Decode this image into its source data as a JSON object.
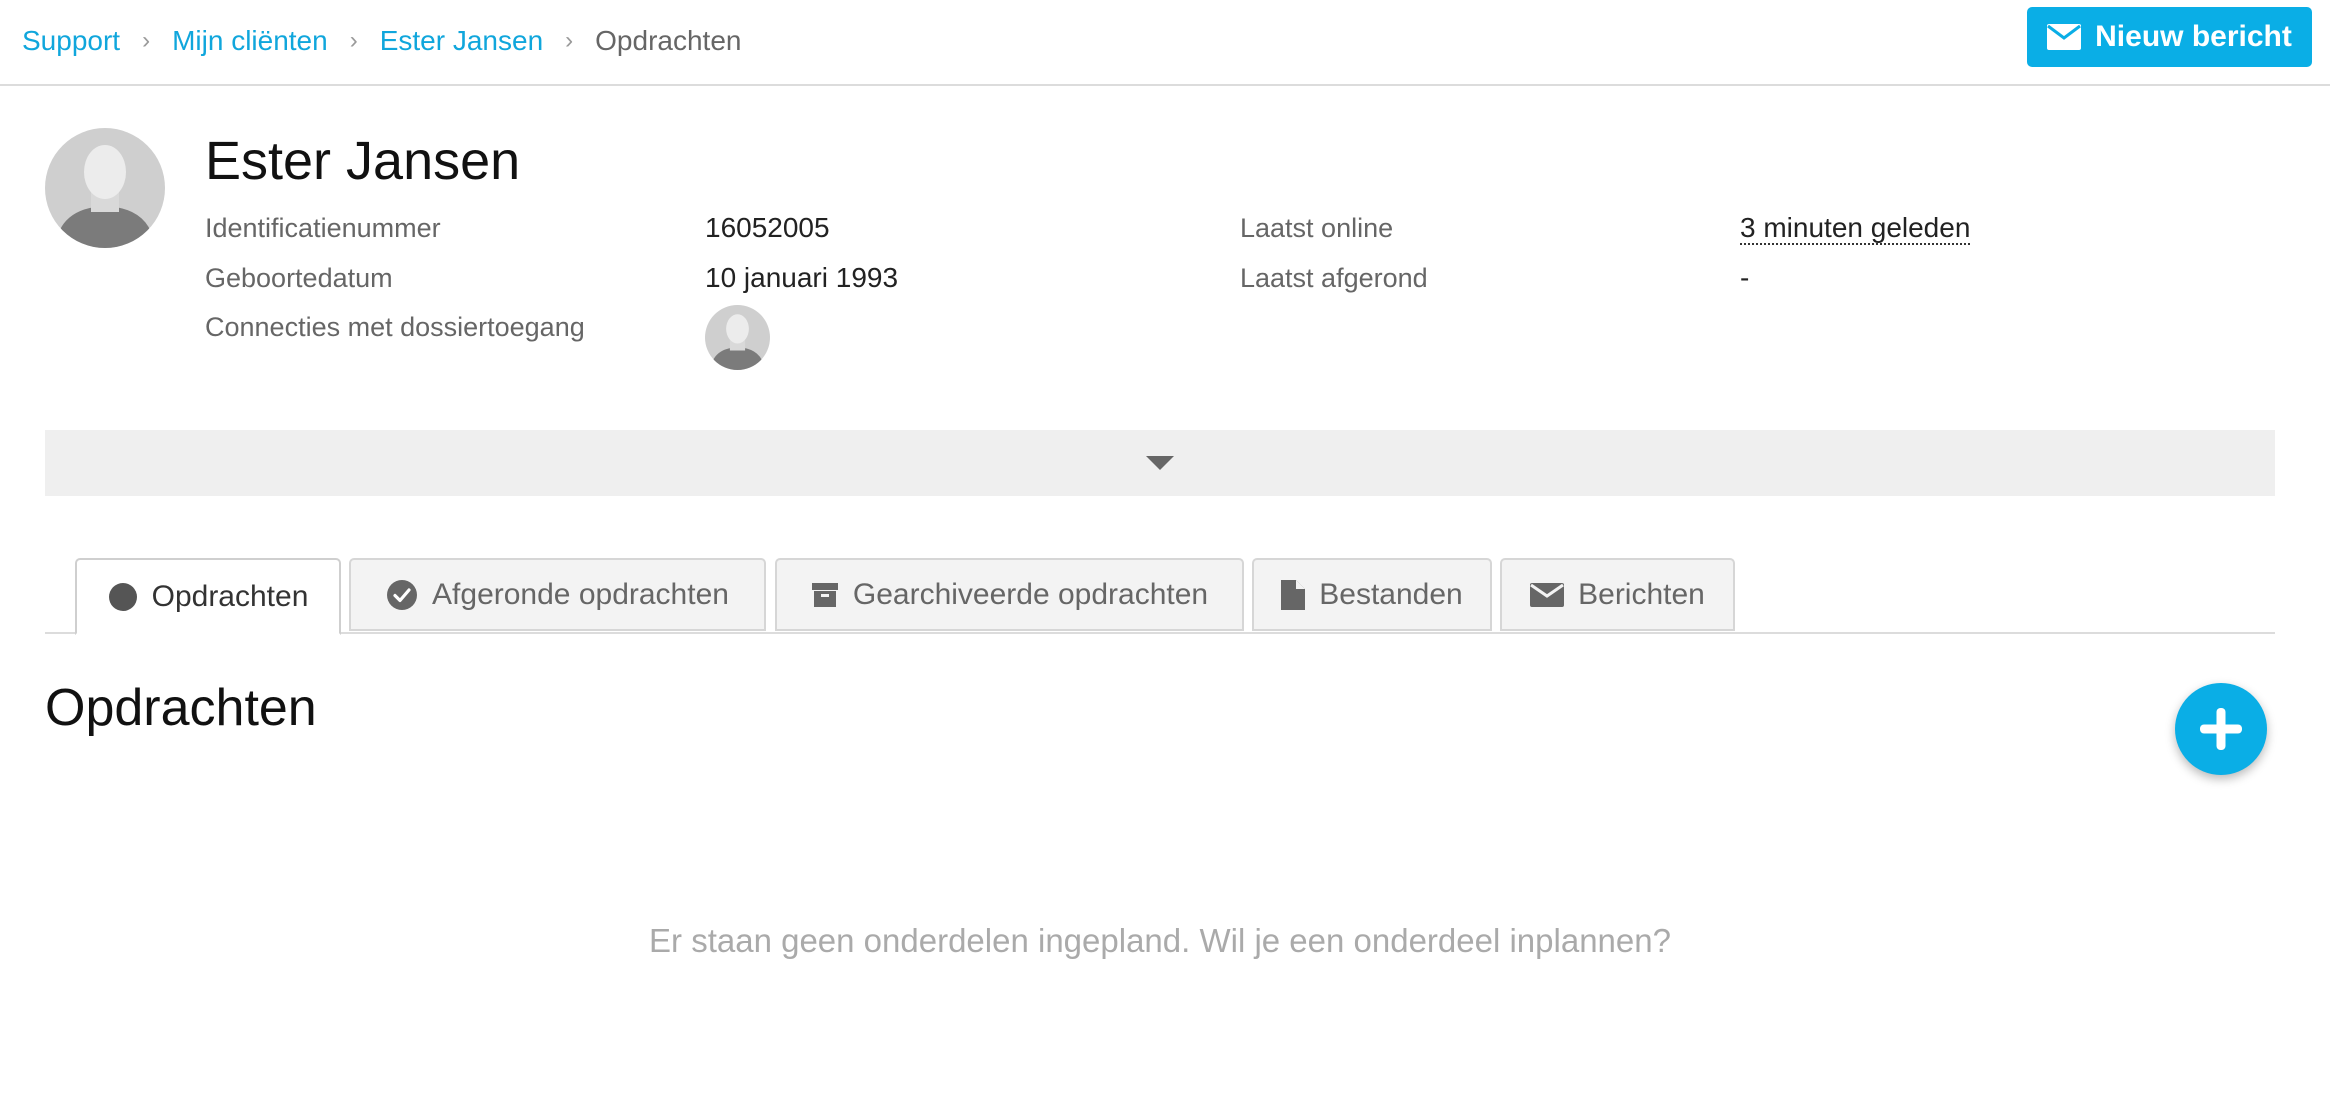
{
  "breadcrumb": {
    "items": [
      "Support",
      "Mijn cliënten",
      "Ester Jansen"
    ],
    "current": "Opdrachten"
  },
  "header": {
    "new_message_label": "Nieuw bericht",
    "new_message_icon": "envelope-icon"
  },
  "client": {
    "name": "Ester Jansen",
    "fields": {
      "id_label": "Identificatienummer",
      "id_value": "16052005",
      "birth_label": "Geboortedatum",
      "birth_value": "10 januari 1993",
      "connections_label": "Connecties met dossiertoegang",
      "last_online_label": "Laatst online",
      "last_online_value": "3 minuten geleden",
      "last_completed_label": "Laatst afgerond",
      "last_completed_value": "-"
    }
  },
  "tabs": [
    {
      "label": "Opdrachten",
      "icon": "circle-icon",
      "active": true
    },
    {
      "label": "Afgeronde opdrachten",
      "icon": "check-circle-icon",
      "active": false
    },
    {
      "label": "Gearchiveerde opdrachten",
      "icon": "archive-icon",
      "active": false
    },
    {
      "label": "Bestanden",
      "icon": "file-icon",
      "active": false
    },
    {
      "label": "Berichten",
      "icon": "envelope-icon",
      "active": false
    }
  ],
  "section": {
    "title": "Opdrachten",
    "empty_message": "Er staan geen onderdelen ingepland. Wil je een onderdeel inplannen?"
  },
  "colors": {
    "accent": "#0aaee6",
    "link": "#10a6dc",
    "muted": "#666666",
    "panel": "#efefef"
  }
}
